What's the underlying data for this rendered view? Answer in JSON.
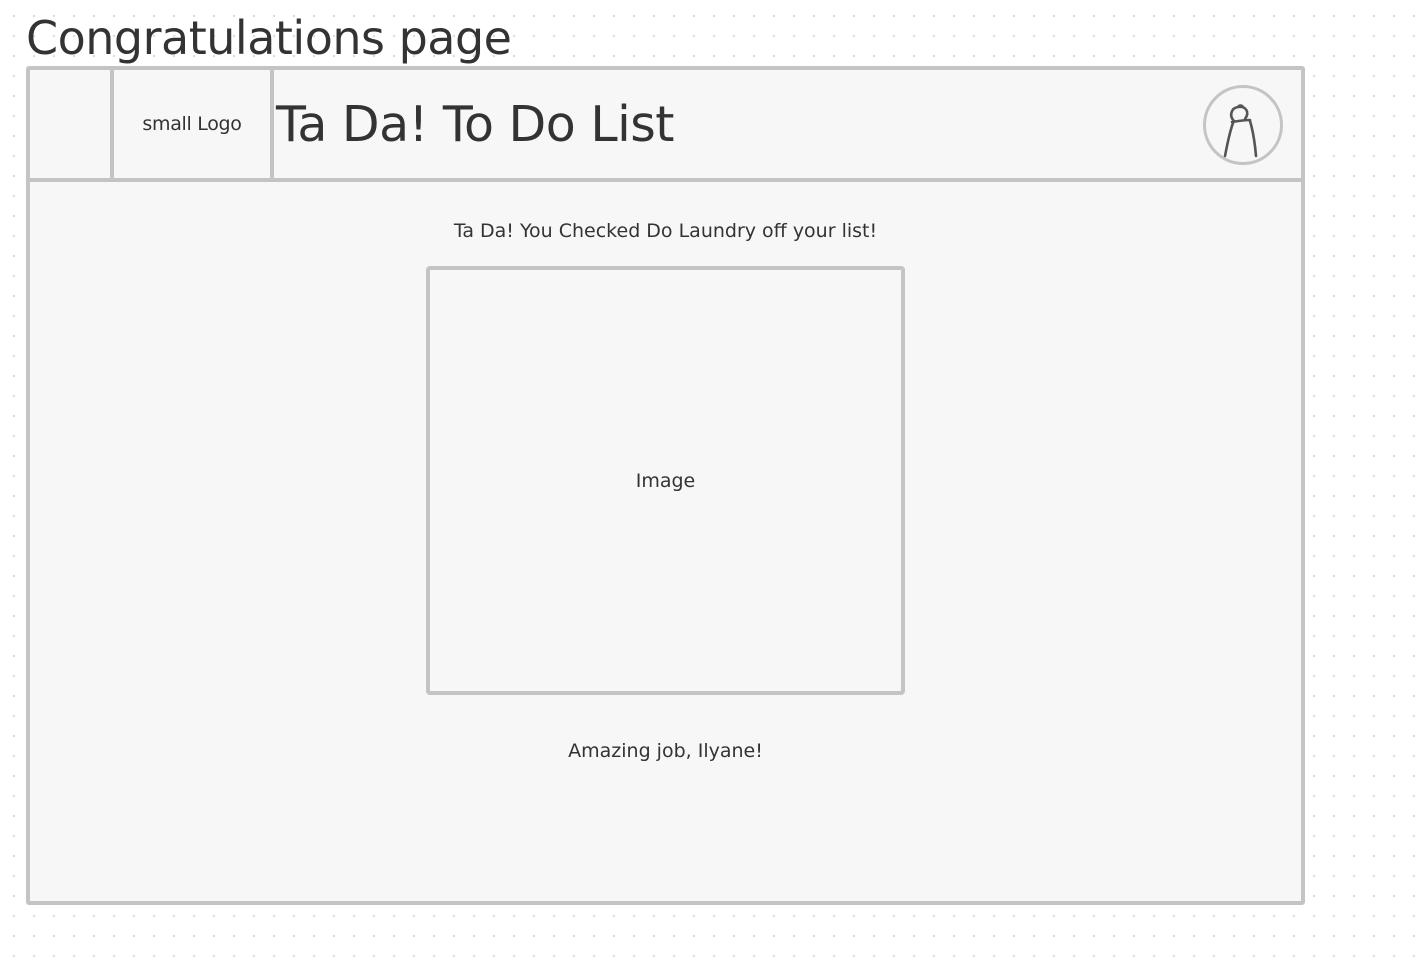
{
  "page": {
    "title": "Congratulations page"
  },
  "header": {
    "logo_text": "small Logo",
    "app_title": "Ta Da! To Do List",
    "avatar_icon": "user-profile-icon"
  },
  "main": {
    "message": "Ta Da! You Checked Do Laundry off your list!",
    "image_placeholder": "Image",
    "praise": "Amazing job, Ilyane!"
  },
  "colors": {
    "frame_border": "#c4c4c4",
    "frame_fill": "#f7f7f7",
    "text": "#333333"
  }
}
